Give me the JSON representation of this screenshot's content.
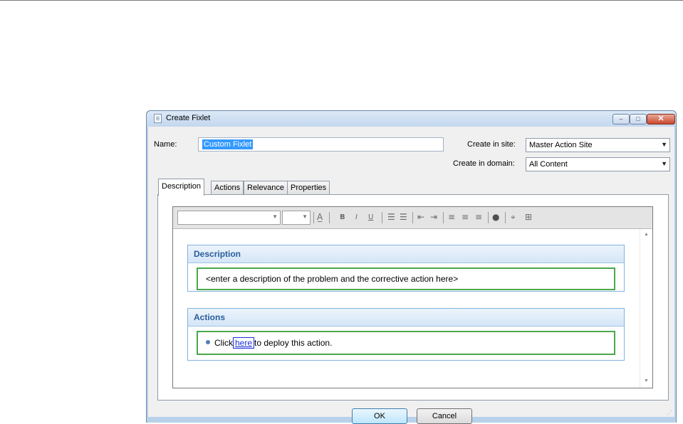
{
  "window": {
    "title": "Create Fixlet",
    "min_glyph": "–",
    "max_glyph": "□",
    "close_glyph": "✕"
  },
  "form": {
    "name_label": "Name:",
    "name_value": "Custom Fixlet",
    "site_label": "Create in site:",
    "site_value": "Master Action Site",
    "domain_label": "Create in domain:",
    "domain_value": "All Content"
  },
  "tabs": [
    {
      "label": "Description",
      "active": true
    },
    {
      "label": "Actions",
      "active": false
    },
    {
      "label": "Relevance",
      "active": false
    },
    {
      "label": "Properties",
      "active": false
    }
  ],
  "toolbar": {
    "font_family_value": "",
    "font_size_value": "",
    "icons": [
      "font-color-icon",
      "bold-icon",
      "italic-icon",
      "underline-icon",
      "numbered-list-icon",
      "bullet-list-icon",
      "outdent-icon",
      "indent-icon",
      "align-left-icon",
      "align-center-icon",
      "align-right-icon",
      "insert-link-icon",
      "clean-format-icon",
      "insert-table-icon"
    ]
  },
  "description_section": {
    "header": "Description",
    "text": "<enter a description of the problem and the corrective action here>"
  },
  "actions_section": {
    "header": "Actions",
    "before_link": "Click",
    "link_text": "here",
    "after_link": "to deploy this action."
  },
  "buttons": {
    "ok": "OK",
    "cancel": "Cancel"
  },
  "colors": {
    "section_header_text": "#2a5d9c",
    "section_border": "#7fb2e0",
    "field_box_border": "#4aa84a",
    "link": "#1a2fd6",
    "selection": "#3399ff"
  }
}
